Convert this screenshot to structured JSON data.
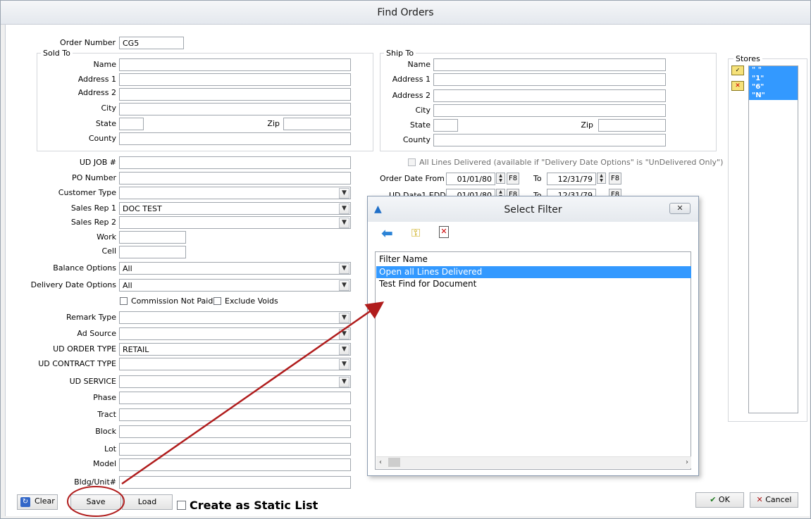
{
  "window": {
    "title": "Find Orders"
  },
  "order": {
    "number_label": "Order Number",
    "number_value": "CG5"
  },
  "sold_to": {
    "legend": "Sold To",
    "name": "Name",
    "address1": "Address 1",
    "address2": "Address 2",
    "city": "City",
    "state": "State",
    "zip": "Zip",
    "county": "County"
  },
  "ship_to": {
    "legend": "Ship To",
    "name": "Name",
    "address1": "Address 1",
    "address2": "Address 2",
    "city": "City",
    "state": "State",
    "zip": "Zip",
    "county": "County"
  },
  "fields": {
    "ud_job": "UD JOB #",
    "po_number": "PO Number",
    "customer_type": "Customer Type",
    "sales_rep1": "Sales Rep 1",
    "sales_rep1_value": "DOC TEST",
    "sales_rep2": "Sales Rep 2",
    "work": "Work",
    "cell": "Cell",
    "balance_options": "Balance Options",
    "balance_options_value": "All",
    "delivery_date_options": "Delivery Date Options",
    "delivery_date_options_value": "All",
    "commission_not_paid": "Commission Not Paid",
    "exclude_voids": "Exclude Voids",
    "remark_type": "Remark Type",
    "ad_source": "Ad Source",
    "ud_order_type": "UD ORDER TYPE",
    "ud_order_type_value": "RETAIL",
    "ud_contract_type": "UD CONTRACT TYPE",
    "ud_service": "UD SERVICE",
    "phase": "Phase",
    "tract": "Tract",
    "block": "Block",
    "lot": "Lot",
    "model": "Model",
    "bldg_unit": "Bldg/Unit#"
  },
  "dates": {
    "all_lines_delivered": "All Lines Delivered (available if \"Delivery Date Options\" is \"UnDelivered Only\")",
    "order_date_from": "Order Date From",
    "from_value": "01/01/80",
    "to_label": "To",
    "to_value": "12/31/79",
    "f8": "F8",
    "ud_date_label": "UD Date1 EDD",
    "ud_from_value": "01/01/80",
    "ud_to_value": "12/31/79"
  },
  "stores": {
    "legend": "Stores",
    "items": [
      "\" \"",
      "\"1\"",
      "\"6\"",
      "\"N\""
    ]
  },
  "buttons": {
    "clear": "Clear",
    "save": "Save",
    "load": "Load",
    "static_list": "Create as Static List",
    "ok": "OK",
    "cancel": "Cancel"
  },
  "dialog": {
    "title": "Select Filter",
    "column": "Filter Name",
    "items": [
      "Open all Lines Delivered",
      "Test Find for Document"
    ]
  },
  "colors": {
    "selection": "#3399ff",
    "annotation": "#b01c1c"
  }
}
